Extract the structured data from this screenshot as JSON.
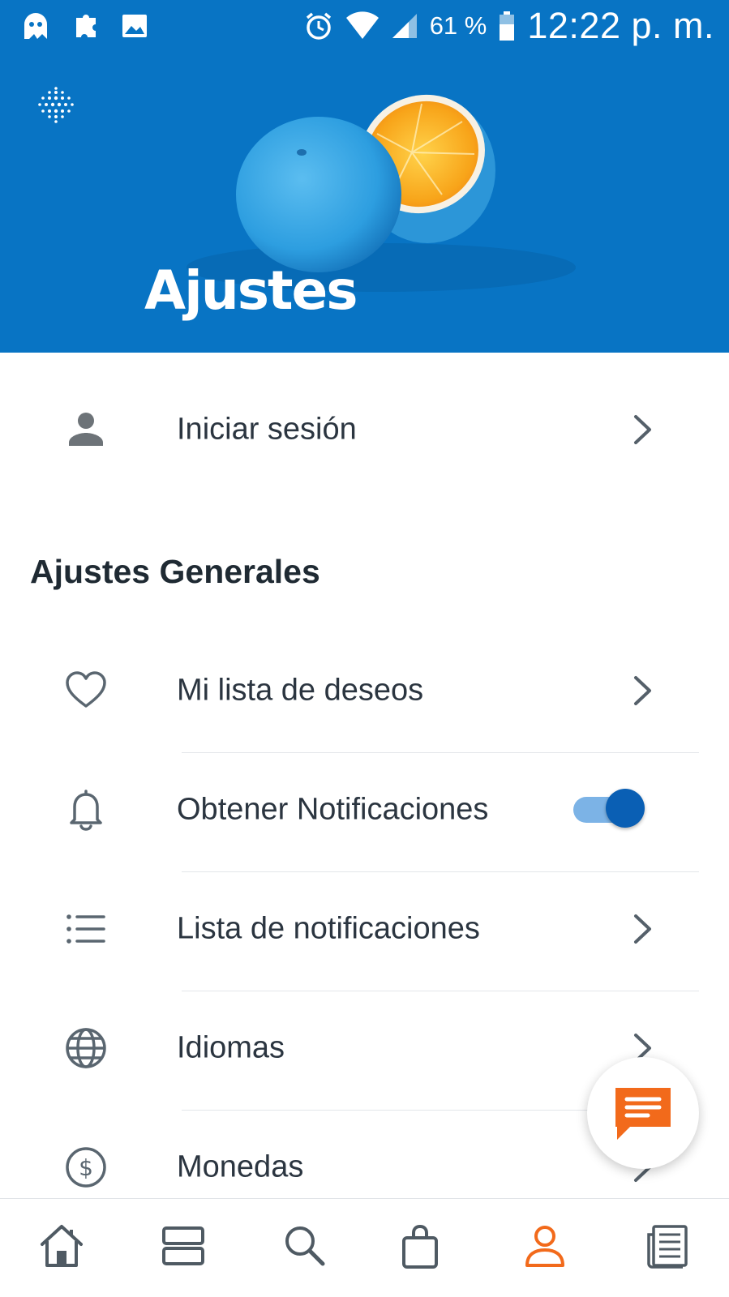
{
  "status_bar": {
    "battery_percent": "61 %",
    "time": "12:22 p. m."
  },
  "header": {
    "title": "Ajustes"
  },
  "account": {
    "login_label": "Iniciar sesión"
  },
  "general_settings": {
    "section_title": "Ajustes Generales",
    "items": [
      {
        "label": "Mi lista de deseos",
        "icon": "heart-icon",
        "control": "chevron"
      },
      {
        "label": "Obtener Notificaciones",
        "icon": "bell-icon",
        "control": "toggle",
        "toggle_on": true
      },
      {
        "label": "Lista de notificaciones",
        "icon": "list-icon",
        "control": "chevron"
      },
      {
        "label": "Idiomas",
        "icon": "globe-icon",
        "control": "chevron"
      },
      {
        "label": "Monedas",
        "icon": "dollar-icon",
        "control": "chevron"
      }
    ]
  },
  "bottom_nav": {
    "items": [
      "home-icon",
      "categories-icon",
      "search-icon",
      "bag-icon",
      "profile-icon",
      "news-icon"
    ],
    "active": "profile-icon"
  },
  "colors": {
    "header_bg": "#0874c4",
    "accent": "#f26a1b",
    "toggle_thumb": "#0a5fb4",
    "toggle_track": "#7cb3e6",
    "text": "#2b3540",
    "icon": "#5a6670"
  }
}
